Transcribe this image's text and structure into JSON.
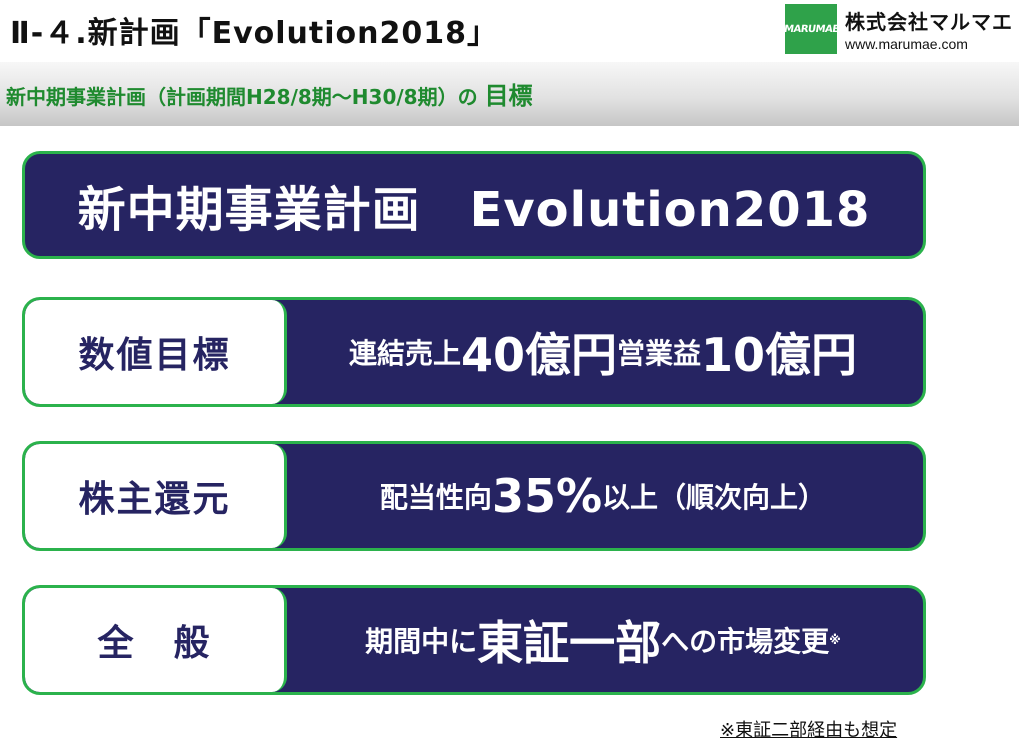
{
  "header": {
    "title": "Ⅱ-４.新計画「Evolution2018」",
    "logo_mark": "MARUMAE",
    "company": "株式会社マルマエ",
    "url": "www.marumae.com"
  },
  "subtitle": {
    "main": "新中期事業計画（計画期間H28/8期～H30/8期）の",
    "emphasis": "目標"
  },
  "plan_title": "新中期事業計画　Evolution2018",
  "rows": [
    {
      "label": "数値目標",
      "parts": [
        "連結売上",
        "40億円",
        "営業益",
        "10億円"
      ]
    },
    {
      "label": "株主還元",
      "parts": [
        "配当性向",
        "35%",
        "以上（順次向上）"
      ]
    },
    {
      "label": "全　般",
      "parts": [
        "期間中に",
        "東証一部",
        "への市場変更",
        "※"
      ]
    }
  ],
  "footnote": "※東証二部経由も想定",
  "colors": {
    "navy": "#262462",
    "green_border": "#2bb24c",
    "subtitle_green": "#1f8a2f",
    "logo_green": "#2fa24a"
  }
}
